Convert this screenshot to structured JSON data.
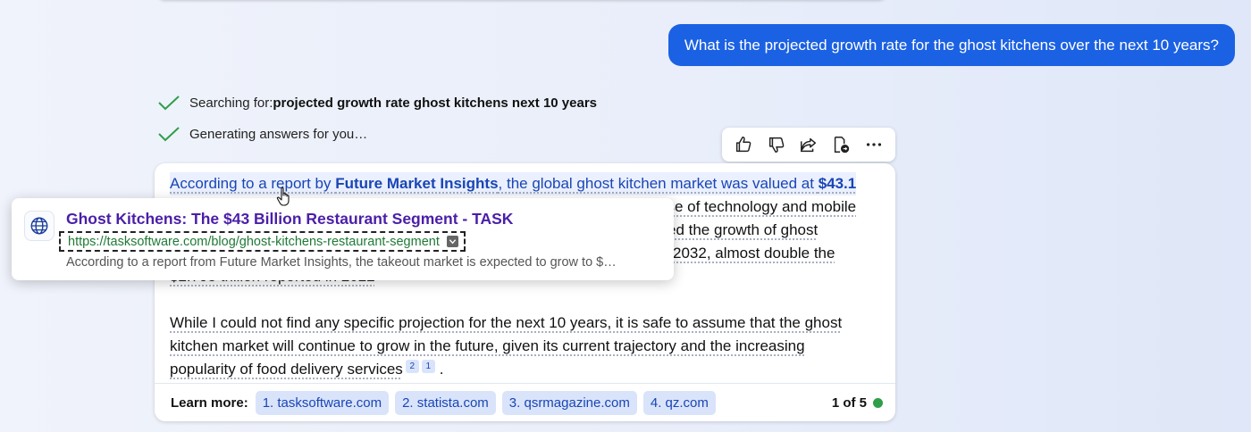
{
  "user_message": "What is the projected growth rate for the ghost kitchens over the next 10 years?",
  "status": [
    {
      "prefix": "Searching for: ",
      "bold": "projected growth rate ghost kitchens next 10 years"
    },
    {
      "prefix": "Generating answers for you…",
      "bold": ""
    }
  ],
  "answer": {
    "p1_line1": {
      "a": "According to a report by ",
      "b": "Future Market Insights",
      "c": ", the global ghost kitchen market was valued at ",
      "d": "$43.1"
    },
    "p1_line2_tail": "rise of technology and mobile",
    "p1_line3_tail": "ed the growth of ghost",
    "p1_line4_tail": "2032, almost double the",
    "p1_line5": "$2.795 trillion reported in 2022",
    "p2_lines": [
      "While I could not find any specific projection for the next 10 years, it is safe to assume that the ghost",
      "kitchen market will continue to grow in the future, given its current trajectory and the increasing",
      "popularity of food delivery services"
    ],
    "p2_citations": [
      "2",
      "1"
    ],
    "p2_end": "."
  },
  "learn_more": {
    "label": "Learn more:",
    "chips": [
      "1. tasksoftware.com",
      "2. statista.com",
      "3. qsrmagazine.com",
      "4. qz.com"
    ],
    "page": "1 of 5"
  },
  "actions": [
    "thumbs-up",
    "thumbs-down",
    "share",
    "export",
    "more"
  ],
  "popup": {
    "title": "Ghost Kitchens: The $43 Billion Restaurant Segment - TASK",
    "url": "https://tasksoftware.com/blog/ghost-kitchens-restaurant-segment",
    "snippet": "According to a report from Future Market Insights, the takeout market is expected to grow to $…"
  },
  "colors": {
    "accent": "#1b61e3",
    "link": "#1a45b4",
    "visited_title": "#4a1ea8",
    "url_green": "#1f7a35",
    "status_dot": "#2e9e49"
  }
}
